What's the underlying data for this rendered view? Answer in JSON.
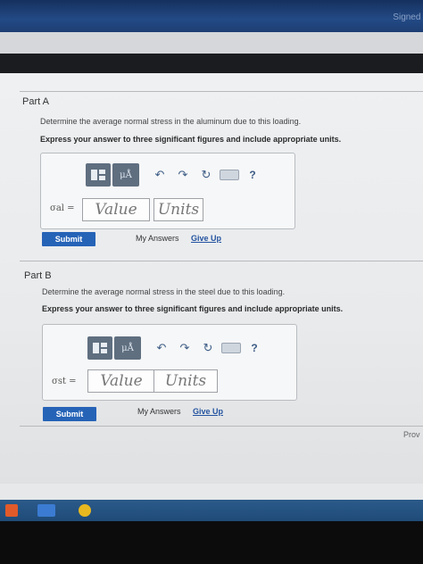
{
  "header": {
    "signed_in": "Signed in"
  },
  "part_a": {
    "title": "Part A",
    "question": "Determine the average normal stress in the aluminum due to this loading.",
    "instruction": "Express your answer to three significant figures and include appropriate units.",
    "toolbar": {
      "mu_label": "μÅ",
      "help": "?"
    },
    "symbol": "σal =",
    "value_placeholder": "Value",
    "units_placeholder": "Units",
    "submit_label": "Submit",
    "my_answers": "My Answers",
    "give_up": "Give Up"
  },
  "part_b": {
    "title": "Part B",
    "question": "Determine the average normal stress in the steel due to this loading.",
    "instruction": "Express your answer to three significant figures and include appropriate units.",
    "toolbar": {
      "mu_label": "μÅ",
      "help": "?"
    },
    "symbol": "σst =",
    "value_placeholder": "Value",
    "units_placeholder": "Units",
    "submit_label": "Submit",
    "my_answers": "My Answers",
    "give_up": "Give Up"
  },
  "footer": {
    "provide_feedback": "Prov"
  },
  "colors": {
    "accent": "#2563b7",
    "topbar": "#1f3f74"
  }
}
